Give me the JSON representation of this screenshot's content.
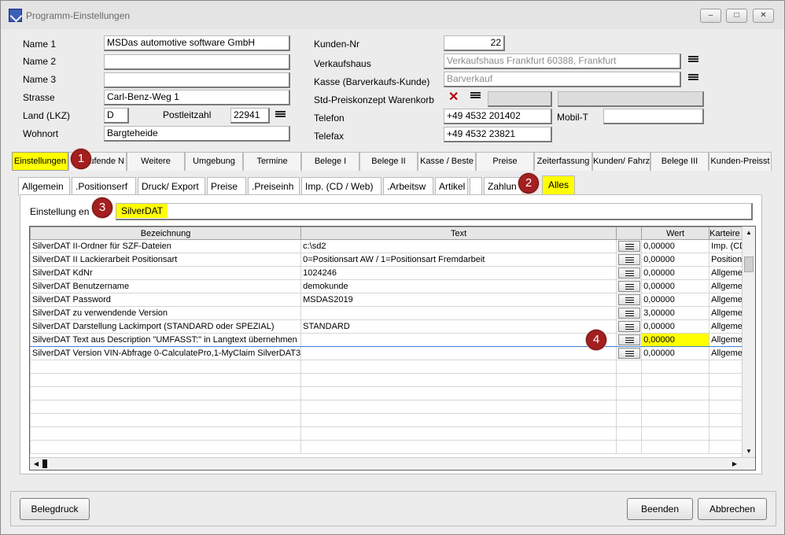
{
  "window": {
    "title": "Programm-Einstellungen"
  },
  "customer": {
    "name1_label": "Name 1",
    "name1": "MSDas automotive software GmbH",
    "name2_label": "Name 2",
    "name2": "",
    "name3_label": "Name 3",
    "name3": "",
    "street_label": "Strasse",
    "street": "Carl-Benz-Weg 1",
    "country_label": "Land (LKZ)",
    "country": "D",
    "zip_label": "Postleitzahl",
    "zip": "22941",
    "city_label": "Wohnort",
    "city": "Bargteheide",
    "custno_label": "Kunden-Nr",
    "custno": "22",
    "store_label": "Verkaufshaus",
    "store": "Verkaufshaus Frankfurt 60388, Frankfurt",
    "till_label": "Kasse (Barverkaufs-Kunde)",
    "till": "Barverkauf",
    "price_label": "Std-Preiskonzept Warenkorb",
    "phone_label": "Telefon",
    "phone": "+49 4532 201402",
    "mobile_label": "Mobil-T",
    "mobile": "",
    "fax_label": "Telefax",
    "fax": "+49 4532 23821"
  },
  "tabs": [
    "Einstellungen",
    "Laufende N",
    "Weitere",
    "Umgebung",
    "Termine",
    "Belege I",
    "Belege II",
    "Kasse / Beste",
    "Preise",
    "Zeiterfassung",
    "Kunden/ Fahrz",
    "Belege III",
    "Kunden-Preisst"
  ],
  "subtabs": [
    "Allgemein",
    ".Positionserf",
    "Druck/ Export",
    "Preise",
    ".Preiseinh",
    "Imp. (CD / Web)",
    ".Arbeitsw",
    "Artikel",
    "",
    "Zahlun",
    "Alles"
  ],
  "filter": {
    "label": "Einstellung en",
    "value": "SilverDAT"
  },
  "badges": [
    "1",
    "2",
    "3",
    "4"
  ],
  "grid": {
    "headers": [
      "Bezeichnung",
      "Text",
      "",
      "Wert",
      "Karteire"
    ],
    "rows": [
      {
        "bez": "SilverDAT II-Ordner für SZF-Dateien",
        "text": "c:\\sd2",
        "wert": "0,00000",
        "kart": "Imp. (CD"
      },
      {
        "bez": "SilverDAT II Lackierarbeit Positionsart",
        "text": "0=Positionsart AW / 1=Positionsart Fremdarbeit",
        "wert": "0,00000",
        "kart": "Positions"
      },
      {
        "bez": "SilverDAT KdNr",
        "text": "1024246",
        "wert": "0,00000",
        "kart": "Allgemein"
      },
      {
        "bez": "SilverDAT Benutzername",
        "text": "demokunde",
        "wert": "0,00000",
        "kart": "Allgemein"
      },
      {
        "bez": "SilverDAT Password",
        "text": "MSDAS2019",
        "wert": "0,00000",
        "kart": "Allgemein"
      },
      {
        "bez": "SilverDAT zu verwendende Version",
        "text": "",
        "wert": "3,00000",
        "kart": "Allgemein"
      },
      {
        "bez": "SilverDAT Darstellung Lackimport (STANDARD oder SPEZIAL)",
        "text": "STANDARD",
        "wert": "0,00000",
        "kart": "Allgemein"
      },
      {
        "bez": "SilverDAT Text aus Description \"UMFASST:\" in Langtext übernehmen",
        "text": "",
        "wert": "0,00000",
        "kart": "Allgemein"
      },
      {
        "bez": "SilverDAT Version VIN-Abfrage 0-CalculatePro,1-MyClaim SilverDAT3",
        "text": "",
        "wert": "0,00000",
        "kart": "Allgemein"
      }
    ]
  },
  "buttons": {
    "print": "Belegdruck",
    "finish": "Beenden",
    "cancel": "Abbrechen"
  },
  "icons": {
    "menu": "lines-icon",
    "clear": "x-icon",
    "minimize": "minimize-icon",
    "maximize": "maximize-icon",
    "close": "close-icon"
  },
  "colors": {
    "highlight": "#ffff00",
    "badge": "#a41f1f"
  }
}
